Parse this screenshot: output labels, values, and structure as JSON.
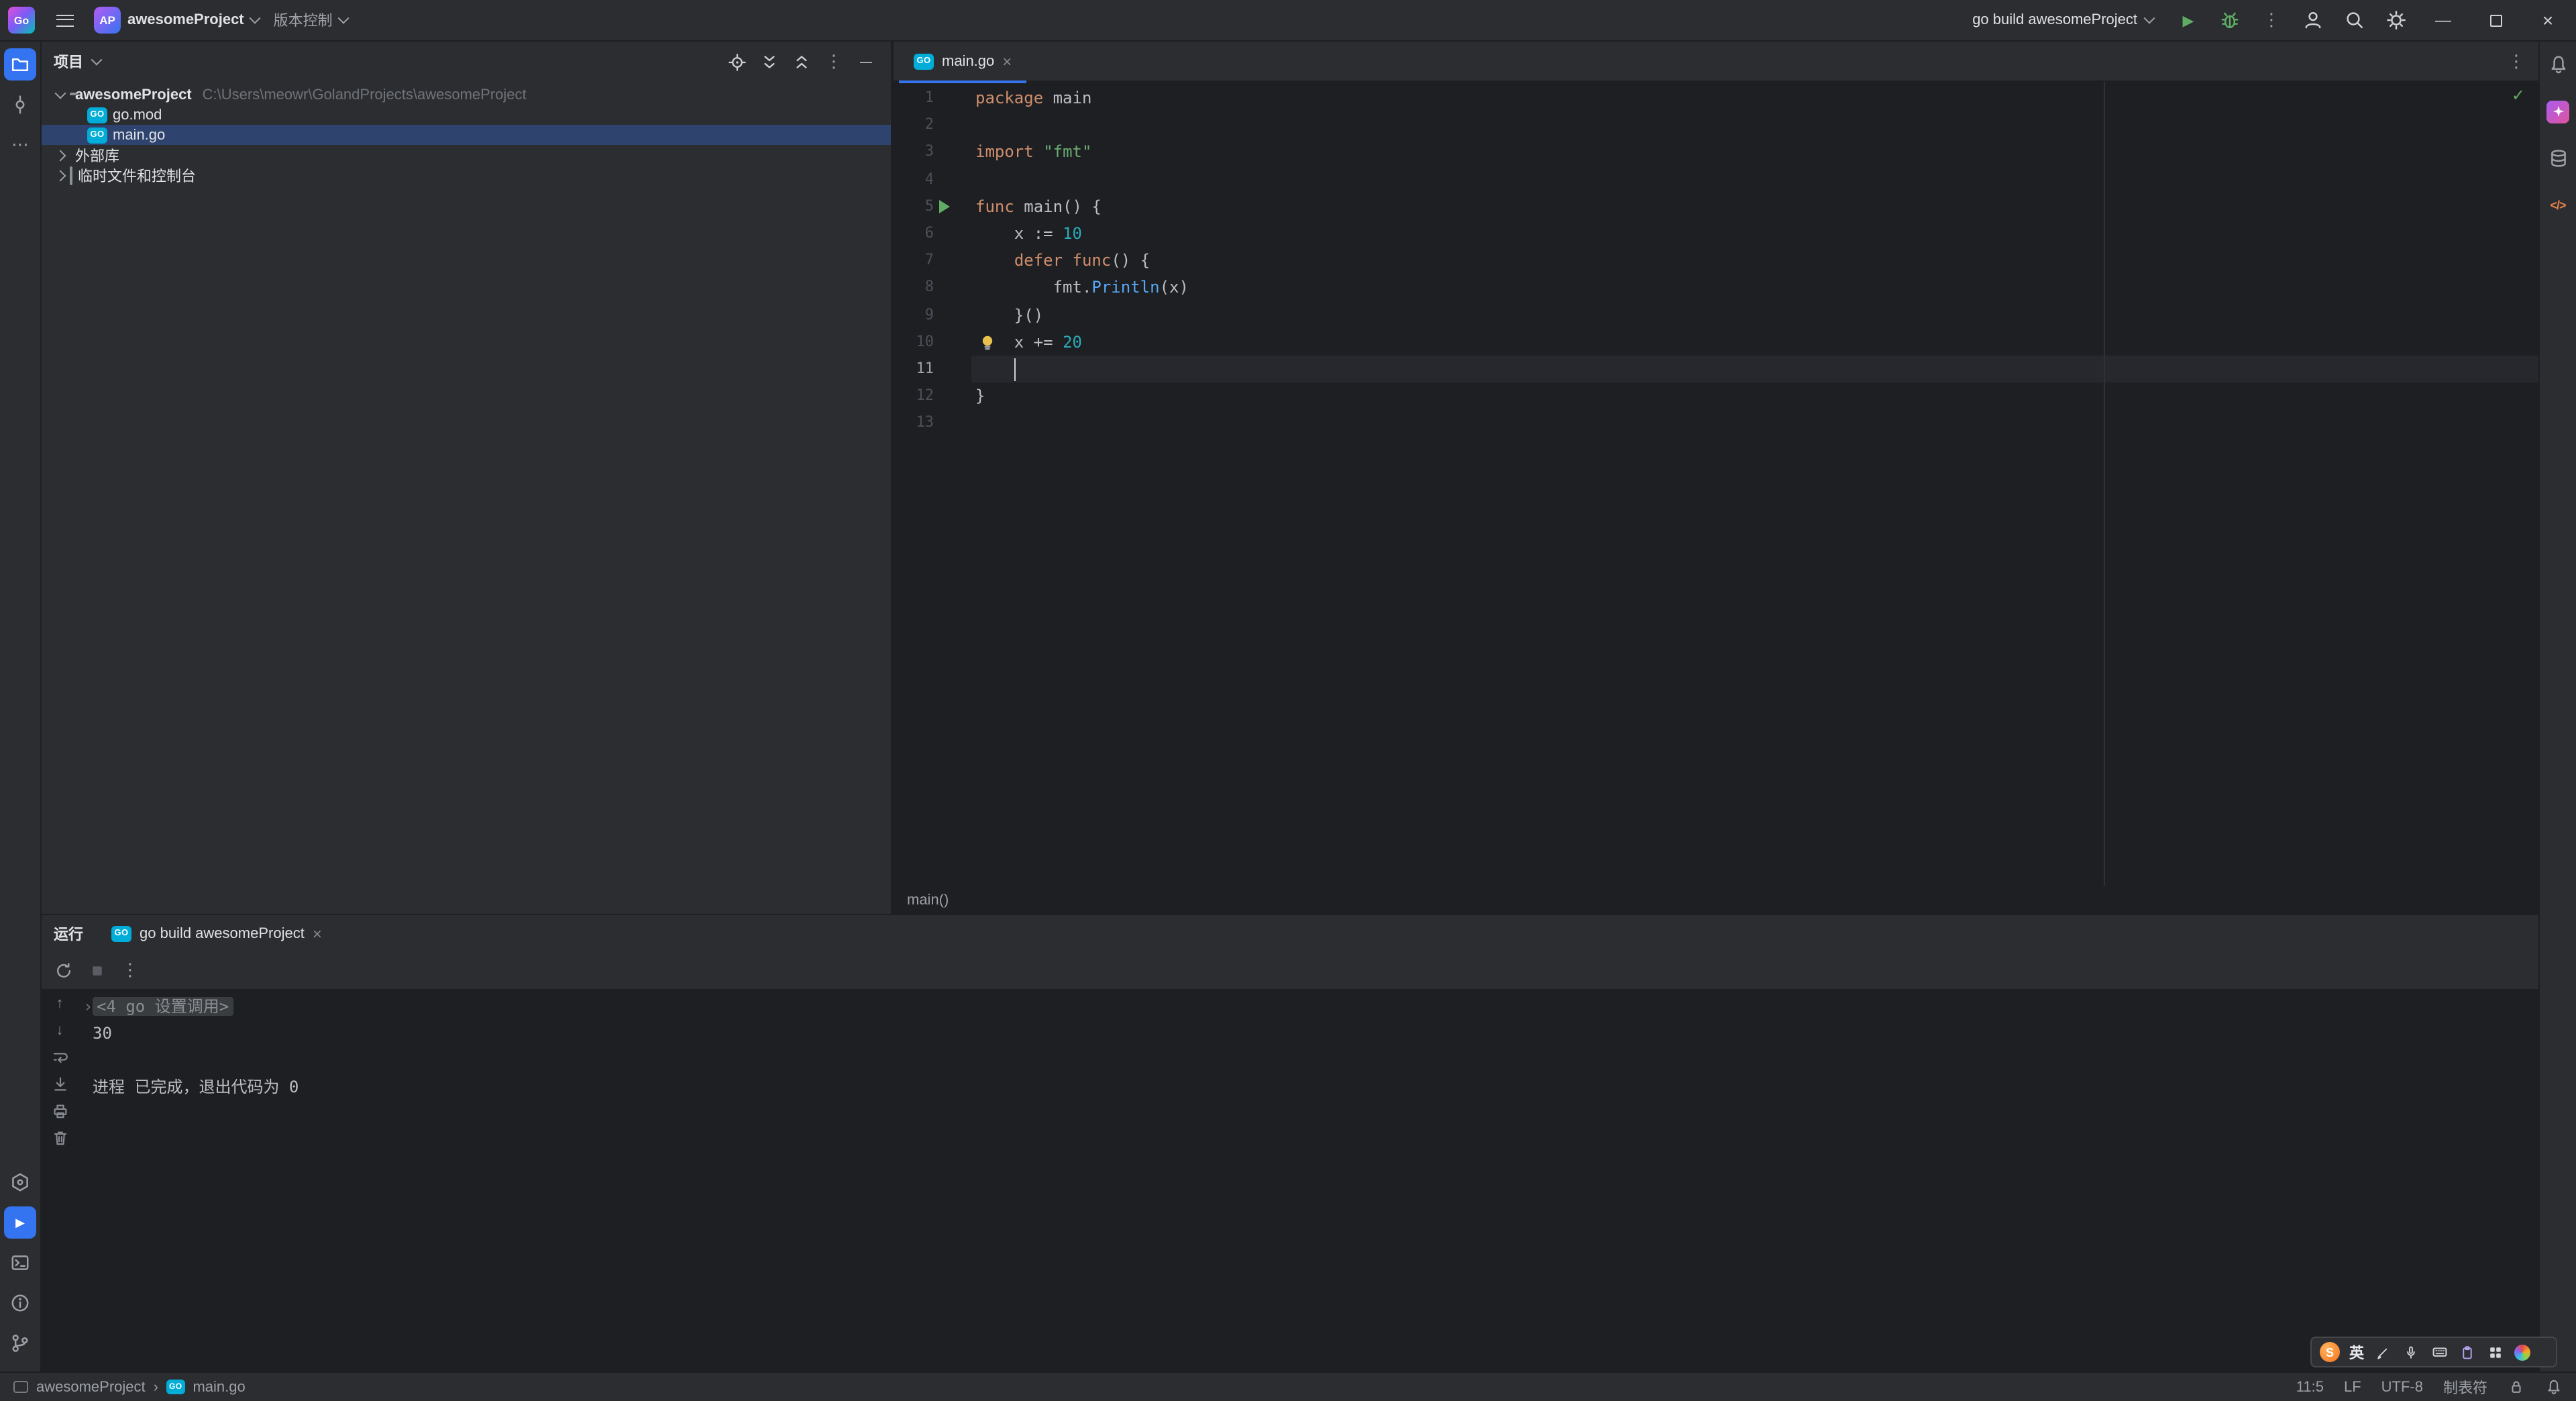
{
  "colors": {
    "accent": "#3574f0",
    "editor_bg": "#1e1f22",
    "panel_bg": "#2b2d30",
    "selection": "#2e436e",
    "keyword": "#cf8e6d",
    "string": "#6aab73",
    "number": "#2aacb8",
    "function_call": "#56a8f5",
    "run_green": "#5fad65",
    "go_brand": "#00add8"
  },
  "title_bar": {
    "app_logo": "Go",
    "project_badge": "AP",
    "project_name": "awesomeProject",
    "vcs_menu": "版本控制",
    "run_config": "go build awesomeProject"
  },
  "project_panel": {
    "title": "项目",
    "tree": [
      {
        "indent": 0,
        "chevron": "down",
        "icon": "folder",
        "label": "awesomeProject",
        "suffix": "C:\\Users\\meowr\\GolandProjects\\awesomeProject",
        "bold": true,
        "selected": false
      },
      {
        "indent": 1,
        "chevron": "none",
        "icon": "go",
        "label": "go.mod",
        "suffix": "",
        "bold": false,
        "selected": false
      },
      {
        "indent": 1,
        "chevron": "none",
        "icon": "go",
        "label": "main.go",
        "suffix": "",
        "bold": false,
        "selected": true
      },
      {
        "indent": 0,
        "chevron": "right",
        "icon": "library",
        "label": "外部库",
        "suffix": "",
        "bold": false,
        "selected": false
      },
      {
        "indent": 0,
        "chevron": "right",
        "icon": "scratch",
        "label": "临时文件和控制台",
        "suffix": "",
        "bold": false,
        "selected": false
      }
    ]
  },
  "editor": {
    "tab_label": "main.go",
    "breadcrumb": "main()",
    "caret": {
      "line": 11,
      "column": 5
    },
    "run_gutter_line": 5,
    "bulb_line": 10,
    "total_lines": 13,
    "lines": [
      {
        "n": 1,
        "seg": [
          [
            "kw",
            "package"
          ],
          [
            "pl",
            " main"
          ]
        ]
      },
      {
        "n": 2,
        "seg": []
      },
      {
        "n": 3,
        "seg": [
          [
            "kw",
            "import"
          ],
          [
            "pl",
            " "
          ],
          [
            "str",
            "\"fmt\""
          ]
        ]
      },
      {
        "n": 4,
        "seg": []
      },
      {
        "n": 5,
        "seg": [
          [
            "kw",
            "func"
          ],
          [
            "pl",
            " main() {"
          ]
        ]
      },
      {
        "n": 6,
        "seg": [
          [
            "pl",
            "    x := "
          ],
          [
            "num",
            "10"
          ]
        ]
      },
      {
        "n": 7,
        "seg": [
          [
            "pl",
            "    "
          ],
          [
            "kw",
            "defer"
          ],
          [
            "pl",
            " "
          ],
          [
            "kw",
            "func"
          ],
          [
            "pl",
            "() {"
          ]
        ]
      },
      {
        "n": 8,
        "seg": [
          [
            "pl",
            "        fmt."
          ],
          [
            "fn",
            "Println"
          ],
          [
            "pl",
            "(x)"
          ]
        ]
      },
      {
        "n": 9,
        "seg": [
          [
            "pl",
            "    }()"
          ]
        ]
      },
      {
        "n": 10,
        "seg": [
          [
            "pl",
            "    x += "
          ],
          [
            "num",
            "20"
          ]
        ]
      },
      {
        "n": 11,
        "seg": []
      },
      {
        "n": 12,
        "seg": [
          [
            "pl",
            "}"
          ]
        ]
      },
      {
        "n": 13,
        "seg": []
      }
    ]
  },
  "run_panel": {
    "title": "运行",
    "tab_label": "go build awesomeProject",
    "console": [
      {
        "type": "fold",
        "text": "<4 go 设置调用>"
      },
      {
        "type": "out",
        "text": "30"
      },
      {
        "type": "blank",
        "text": ""
      },
      {
        "type": "out",
        "text": "进程 已完成，退出代码为 0"
      }
    ]
  },
  "status_bar": {
    "project": "awesomeProject",
    "separator": "›",
    "file": "main.go",
    "caret_position": "11:5",
    "line_separator": "LF",
    "encoding": "UTF-8",
    "indent": "制表符"
  },
  "ime_bar": {
    "logo": "S",
    "lang": "英"
  },
  "glyphs": {
    "more_vertical": "⋮",
    "more_horizontal": "⋯",
    "close": "×",
    "minimize": "—",
    "check": "✓",
    "play": "▶",
    "arrow_up": "↑",
    "arrow_down": "↓",
    "fold_chevron": "›",
    "go_chip": "GO",
    "code_tags": "</>"
  }
}
